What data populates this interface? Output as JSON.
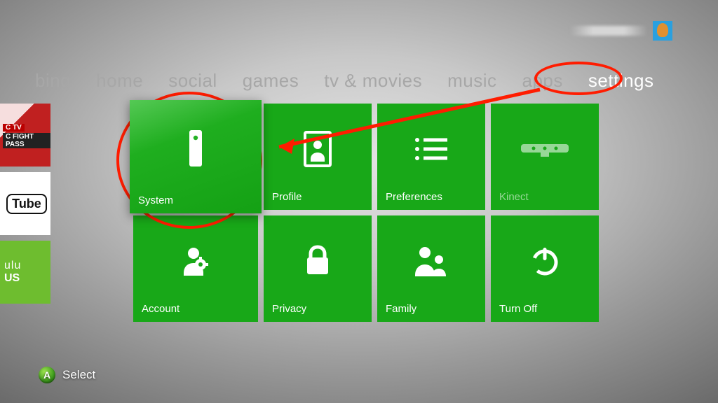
{
  "nav": {
    "items": [
      {
        "label": "bing"
      },
      {
        "label": "home"
      },
      {
        "label": "social"
      },
      {
        "label": "games"
      },
      {
        "label": "tv & movies"
      },
      {
        "label": "music"
      },
      {
        "label": "apps"
      },
      {
        "label": "settings"
      }
    ],
    "active_index": 7
  },
  "tiles": [
    {
      "label": "System",
      "icon": "console-icon",
      "selected": true
    },
    {
      "label": "Profile",
      "icon": "profile-icon"
    },
    {
      "label": "Preferences",
      "icon": "list-icon"
    },
    {
      "label": "Kinect",
      "icon": "kinect-icon",
      "dim": true
    },
    {
      "label": "Account",
      "icon": "account-gear-icon"
    },
    {
      "label": "Privacy",
      "icon": "lock-icon"
    },
    {
      "label": "Family",
      "icon": "family-icon"
    },
    {
      "label": "Turn Off",
      "icon": "power-icon"
    }
  ],
  "edge_tiles": [
    {
      "label_top": "C TV",
      "label_bottom": "C FIGHT PASS"
    },
    {
      "label": "Tube"
    },
    {
      "label_line1": "ulu",
      "label_line2": "US"
    }
  ],
  "hint": {
    "button": "A",
    "text": "Select"
  },
  "annotations": {
    "nav_circle": "settings",
    "tile_circle": "System",
    "arrow_from": "settings",
    "arrow_to": "System"
  },
  "colors": {
    "tile_green": "#18a818",
    "tile_green_selected_top": "#55c955",
    "annotation_red": "#ff1c00"
  }
}
